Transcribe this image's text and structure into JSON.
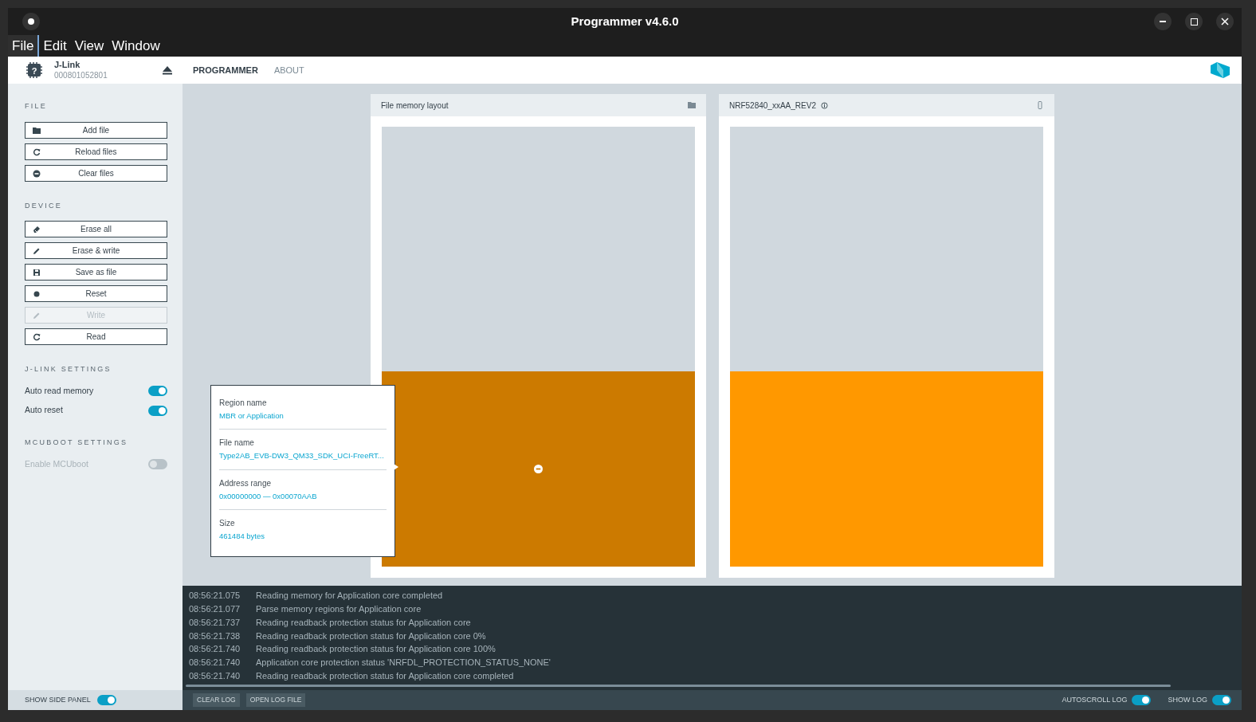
{
  "window": {
    "title": "Programmer v4.6.0"
  },
  "menu": [
    {
      "label": "File",
      "selected": true
    },
    {
      "label": "Edit",
      "selected": false
    },
    {
      "label": "View",
      "selected": false
    },
    {
      "label": "Window",
      "selected": false
    }
  ],
  "device": {
    "name": "J-Link",
    "serial": "000801052801",
    "chip_glyph": "?"
  },
  "nav": [
    {
      "label": "PROGRAMMER",
      "selected": true
    },
    {
      "label": "ABOUT",
      "selected": false
    }
  ],
  "sidebar": [
    {
      "title": "FILE",
      "items": [
        {
          "kind": "button",
          "label": "Add file",
          "disabled": false
        },
        {
          "kind": "button",
          "label": "Reload files",
          "disabled": false
        },
        {
          "kind": "button",
          "label": "Clear files",
          "disabled": false
        }
      ]
    },
    {
      "title": "DEVICE",
      "items": [
        {
          "kind": "button",
          "label": "Erase all",
          "disabled": false
        },
        {
          "kind": "button",
          "label": "Erase & write",
          "disabled": false
        },
        {
          "kind": "button",
          "label": "Save as file",
          "disabled": false
        },
        {
          "kind": "button",
          "label": "Reset",
          "disabled": false
        },
        {
          "kind": "button",
          "label": "Write",
          "disabled": true
        },
        {
          "kind": "button",
          "label": "Read",
          "disabled": false
        }
      ]
    },
    {
      "title": "J-LINK SETTINGS",
      "items": [
        {
          "kind": "toggle",
          "label": "Auto read memory",
          "on": true,
          "disabled": false
        },
        {
          "kind": "toggle",
          "label": "Auto reset",
          "on": true,
          "disabled": false
        }
      ]
    },
    {
      "title": "MCUBOOT SETTINGS",
      "items": [
        {
          "kind": "toggle",
          "label": "Enable MCUboot",
          "on": false,
          "disabled": true
        }
      ]
    }
  ],
  "panels": [
    {
      "title": "File memory layout",
      "hovered": true
    },
    {
      "title": "NRF52840_xxAA_REV2",
      "hovered": false
    }
  ],
  "tooltip": [
    {
      "label": "Region name",
      "value": "MBR or Application"
    },
    {
      "label": "File name",
      "value": "Type2AB_EVB-DW3_QM33_SDK_UCI-FreeRT..."
    },
    {
      "label": "Address range",
      "value": "0x00000000 — 0x00070AAB"
    },
    {
      "label": "Size",
      "value": "461484 bytes"
    }
  ],
  "log": [
    {
      "time": "08:56:21.075",
      "message": "Reading memory for Application core completed"
    },
    {
      "time": "08:56:21.077",
      "message": "Parse memory regions for Application core"
    },
    {
      "time": "08:56:21.737",
      "message": "Reading readback protection status for Application core"
    },
    {
      "time": "08:56:21.738",
      "message": "Reading readback protection status for Application core 0%"
    },
    {
      "time": "08:56:21.740",
      "message": "Reading readback protection status for Application core 100%"
    },
    {
      "time": "08:56:21.740",
      "message": "Application core protection status 'NRFDL_PROTECTION_STATUS_NONE'"
    },
    {
      "time": "08:56:21.740",
      "message": "Reading readback protection status for Application core completed"
    }
  ],
  "footer": {
    "side_panel": {
      "label": "SHOW SIDE PANEL",
      "on": true
    },
    "buttons": [
      "CLEAR LOG",
      "OPEN LOG FILE"
    ],
    "autoscroll": {
      "label": "AUTOSCROLL LOG",
      "on": true
    },
    "show_log": {
      "label": "SHOW LOG",
      "on": true
    }
  }
}
